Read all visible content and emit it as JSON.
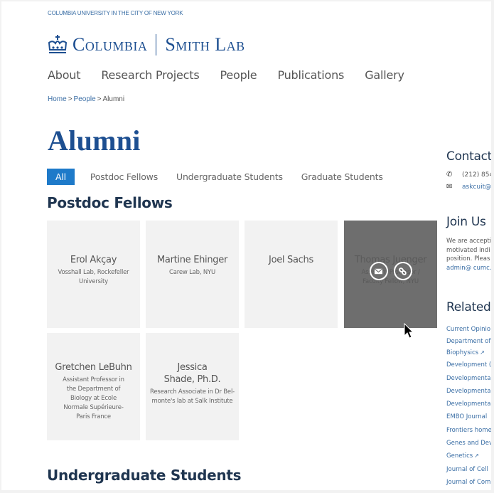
{
  "header": {
    "university_link": "COLUMBIA UNIVERSITY IN THE CITY OF NEW YORK",
    "logo_left": "Columbia",
    "logo_right": "Smith Lab"
  },
  "nav": {
    "items": [
      "About",
      "Research Projects",
      "People",
      "Publications",
      "Gallery"
    ]
  },
  "breadcrumb": {
    "items": [
      "Home",
      "People"
    ],
    "separator": ">",
    "current": "Alumni"
  },
  "page": {
    "title": "Alumni"
  },
  "filters": {
    "active": "All",
    "items": [
      "All",
      "Postdoc Fellows",
      "Undergraduate Students",
      "Graduate Students"
    ]
  },
  "sections": [
    {
      "title": "Postdoc Fellows",
      "people": [
        {
          "name": "Erol Akçay",
          "role": "Vosshall Lab, Rockefeller University"
        },
        {
          "name": "Martine Ehinger",
          "role": "Carew Lab, NYU"
        },
        {
          "name": "Joel Sachs",
          "role": ""
        },
        {
          "name": "Thomas Juenger",
          "role": "Assistant Professor / Faculty Fellow, NYU",
          "hovered": true
        },
        {
          "name": "Gretchen LeBuhn",
          "role": "Assistant Professor in the Department of Biology at Ecole Normale Supérieure-Paris France"
        },
        {
          "name": "Jessica Shade, Ph.D.",
          "role": "Research Associate in Dr Bel-monte's lab at Salk Institute"
        }
      ]
    },
    {
      "title": "Undergraduate Students",
      "people": []
    }
  ],
  "card_overlay": {
    "email_icon": "envelope-icon",
    "link_icon": "chain-link-icon"
  },
  "sidebar": {
    "contact": {
      "title": "Contact",
      "phone": "(212) 854",
      "email": "askcuit@"
    },
    "join": {
      "title": "Join Us",
      "lines": [
        "We are accepti",
        "motivated indi",
        "position. Pleas"
      ],
      "email": "admin@ cumc."
    },
    "related": {
      "title": "Related",
      "links": [
        {
          "label": "Current Opinio",
          "external": false
        },
        {
          "label": "Department of",
          "external": false
        },
        {
          "label": "Biophysics",
          "external": true
        },
        {
          "label": "Development (",
          "external": false
        },
        {
          "label": "Developmenta",
          "external": false
        },
        {
          "label": "Developmenta",
          "external": false
        },
        {
          "label": "Developmenta",
          "external": false
        },
        {
          "label": "EMBO Journal",
          "external": false
        },
        {
          "label": "Frontiers home",
          "external": false
        },
        {
          "label": "Genes and Dev",
          "external": false
        },
        {
          "label": "Genetics",
          "external": true
        },
        {
          "label": "Journal of Cell",
          "external": false
        },
        {
          "label": "Journal of Com",
          "external": false
        }
      ]
    }
  },
  "colors": {
    "brand": "#1d4f91",
    "link": "#3a6ea5",
    "active_filter": "#1e7ac9",
    "card_bg": "#f2f2f2",
    "card_hover": "#6e6e6e"
  }
}
